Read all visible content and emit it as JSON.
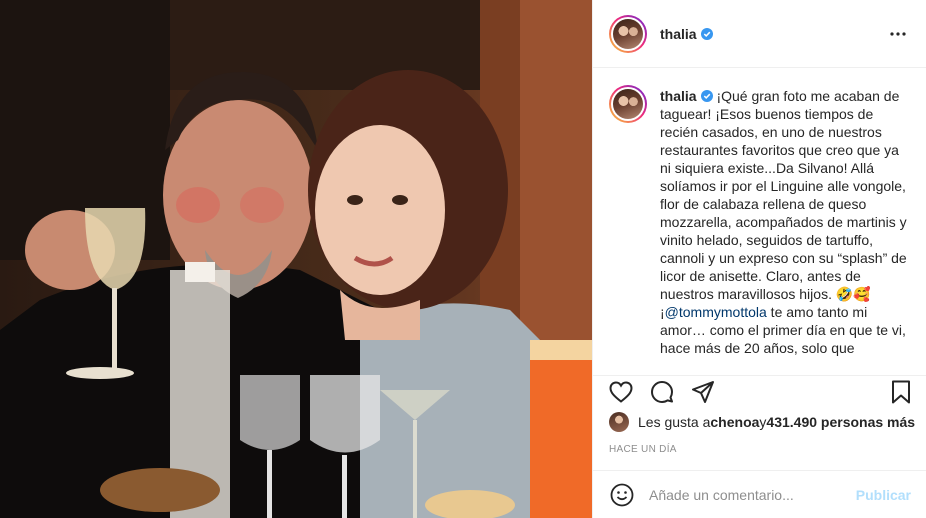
{
  "post": {
    "username": "thalia",
    "caption_user": "thalia",
    "caption_p1": " ¡Qué gran foto me acaban de taguear! ¡Esos buenos tiempos de recién casados, en uno de nuestros restaurantes favoritos que creo que ya ni siquiera existe...Da Silvano! Allá solíamos ir por el Linguine alle vongole, flor de calabaza rellena de queso mozzarella, acompañados de martinis y vinito helado, seguidos de tartuffo, cannoli y un expreso con su “splash” de licor de anisette. Claro, antes de nuestros maravillosos hijos. ",
    "caption_emoji": "🤣🥰",
    "caption_p2": " ¡",
    "caption_mention": "@tommymottola",
    "caption_p3": " te amo tanto mi amor… como el primer día en que te vi, hace más de 20 años, solo que",
    "likes_prefix": "Les gusta a ",
    "likes_user": "chenoa",
    "likes_mid": " y ",
    "likes_count": "431.490 personas más",
    "timestamp": "HACE UN DÍA",
    "comment_placeholder": "Añade un comentario...",
    "publish_label": "Publicar"
  },
  "icons": {
    "more": "more-options-icon",
    "like": "heart-icon",
    "comment": "comment-icon",
    "share": "share-icon",
    "save": "bookmark-icon",
    "emoji": "emoji-icon",
    "verified": "verified-badge-icon"
  },
  "colors": {
    "verified": "#3897f0",
    "mention": "#00376b",
    "publish_disabled": "#b2dffc",
    "muted": "#8e8e8e"
  }
}
